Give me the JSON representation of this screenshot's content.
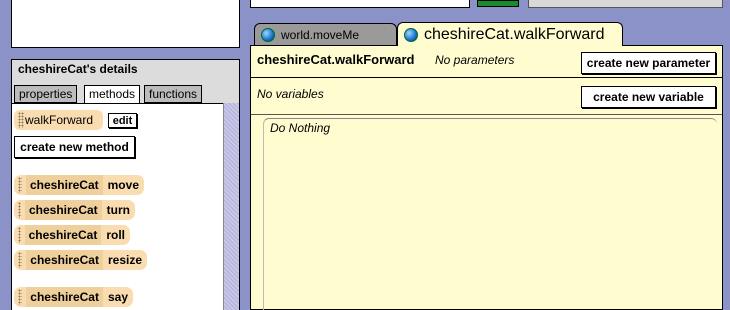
{
  "details": {
    "title": "cheshireCat's details",
    "tabs": [
      {
        "label": "properties"
      },
      {
        "label": "methods"
      },
      {
        "label": "functions"
      }
    ],
    "user_method": {
      "label": "walkForward",
      "edit_label": "edit"
    },
    "create_method_label": "create new method",
    "builtin_methods": [
      {
        "object": "cheshireCat",
        "method": "move"
      },
      {
        "object": "cheshireCat",
        "method": "turn"
      },
      {
        "object": "cheshireCat",
        "method": "roll"
      },
      {
        "object": "cheshireCat",
        "method": "resize"
      },
      {
        "object": "cheshireCat",
        "method": "say"
      }
    ]
  },
  "editor": {
    "tabs": [
      {
        "label": "world.moveMe"
      },
      {
        "label": "cheshireCat.walkForward"
      }
    ],
    "method_title": "cheshireCat.walkForward",
    "params_text": "No parameters",
    "create_param_label": "create new parameter",
    "vars_text": "No variables",
    "create_var_label": "create new variable",
    "body_text": "Do Nothing"
  },
  "colors": {
    "background": "#8a92c8",
    "tile": "#f9dcb0",
    "editor_bg": "#fffdd0"
  }
}
